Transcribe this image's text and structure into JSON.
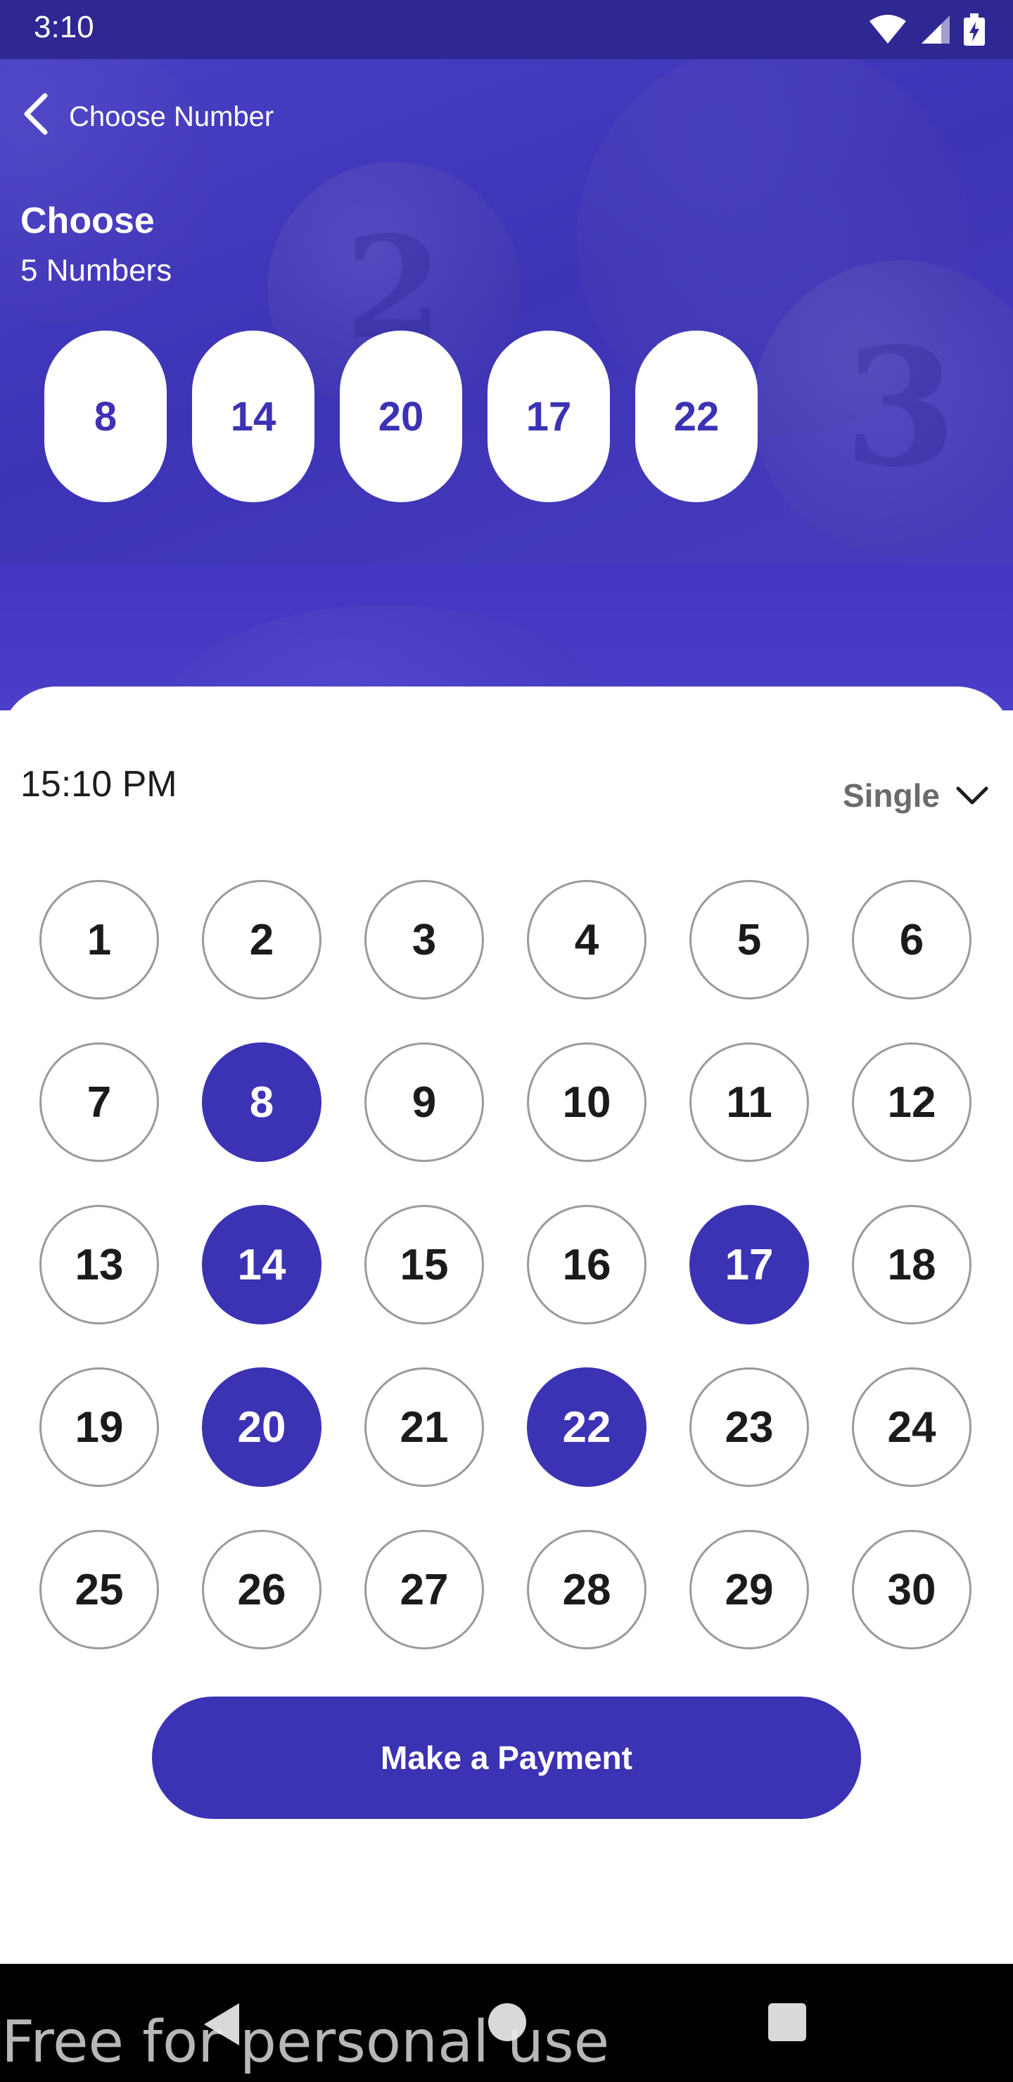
{
  "status_bar": {
    "time": "3:10",
    "icons": [
      "wifi-icon",
      "signal-icon",
      "battery-charging-icon"
    ]
  },
  "app_bar": {
    "back_icon": "chevron-left-icon",
    "title": "Choose Number"
  },
  "header": {
    "title": "Choose",
    "subtitle": "5 Numbers",
    "background_balls": [
      "2",
      "3"
    ]
  },
  "selected_numbers": [
    "8",
    "14",
    "20",
    "17",
    "22"
  ],
  "picker": {
    "time": "15:10 PM",
    "mode": "Single",
    "mode_icon": "chevron-down-icon",
    "numbers": [
      "1",
      "2",
      "3",
      "4",
      "5",
      "6",
      "7",
      "8",
      "9",
      "10",
      "11",
      "12",
      "13",
      "14",
      "15",
      "16",
      "17",
      "18",
      "19",
      "20",
      "21",
      "22",
      "23",
      "24",
      "25",
      "26",
      "27",
      "28",
      "29",
      "30"
    ],
    "selected": [
      "8",
      "14",
      "17",
      "20",
      "22"
    ]
  },
  "actions": {
    "pay_label": "Make a Payment"
  },
  "nav_bar": {
    "icons": [
      "nav-back-icon",
      "nav-home-icon",
      "nav-recent-apps-icon"
    ]
  },
  "watermark": "Free for personal use",
  "colors": {
    "accent": "#3c32b4",
    "hero_bg": "#4a41c7",
    "status_bar": "#2f2792",
    "unselected_border": "#9a9a9a"
  }
}
